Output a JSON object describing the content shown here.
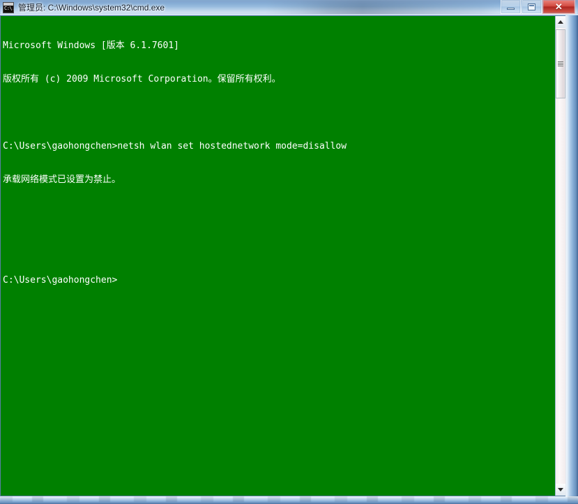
{
  "window": {
    "title": "管理员: C:\\Windows\\system32\\cmd.exe",
    "icon_glyph": "C:\\.",
    "colors": {
      "console_background": "#008000",
      "console_foreground": "#ffffff",
      "close_button": "#af1e16",
      "frame": "#5a7fa5"
    },
    "caption_buttons": {
      "minimize_label": "",
      "maximize_label": "",
      "close_label": "✕"
    }
  },
  "console": {
    "lines": [
      "Microsoft Windows [版本 6.1.7601]",
      "版权所有 (c) 2009 Microsoft Corporation。保留所有权利。",
      "",
      "C:\\Users\\gaohongchen>netsh wlan set hostednetwork mode=disallow",
      "承载网络模式已设置为禁止。",
      "",
      "",
      "C:\\Users\\gaohongchen>"
    ]
  },
  "scrollbar": {
    "up_arrow": "▲",
    "down_arrow": "▼"
  }
}
